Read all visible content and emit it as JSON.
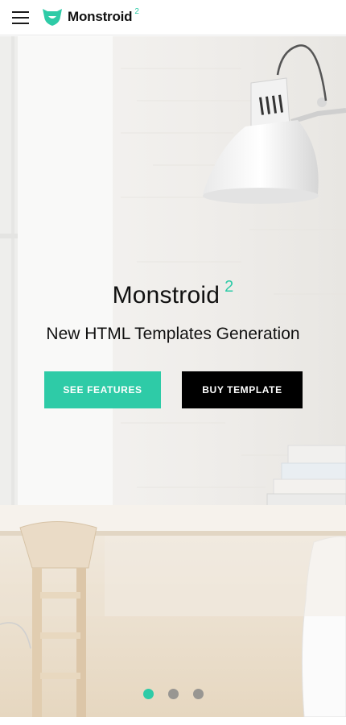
{
  "header": {
    "brand": "Monstroid",
    "brand_sup": "2",
    "menu_icon": "hamburger-icon",
    "logo_icon": "monster-face-logo"
  },
  "hero": {
    "title": "Monstroid",
    "title_sup": "2",
    "subtitle": "New HTML Templates Generation",
    "buttons": {
      "features": "SEE FEATURES",
      "buy": "BUY TEMPLATE"
    },
    "slider": {
      "slide_count": 3,
      "active_slide": 1
    }
  },
  "colors": {
    "accent": "#2ecba7",
    "dark": "#000000",
    "text": "#111111"
  }
}
